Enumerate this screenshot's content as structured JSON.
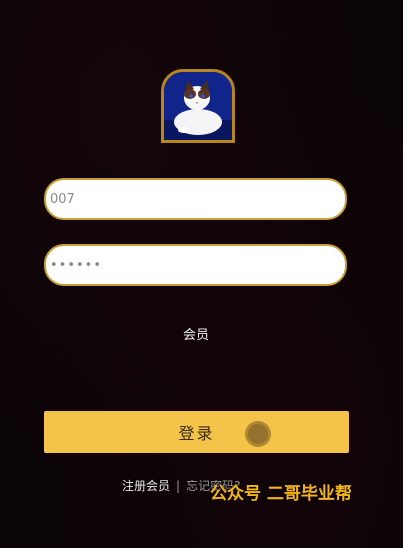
{
  "login": {
    "avatar": "ragdoll-cat-photo",
    "username_value": "007",
    "password_value": "••••••",
    "role_label": "会员",
    "submit_label": "登录",
    "register_link": "注册会员",
    "separator": "|",
    "forgot_link": "忘记密码?"
  },
  "watermark": "公众号 二哥毕业帮",
  "colors": {
    "background": "#0b0406",
    "accent": "#f4c44a",
    "border": "#c8a03a",
    "watermark": "#f3b416"
  }
}
